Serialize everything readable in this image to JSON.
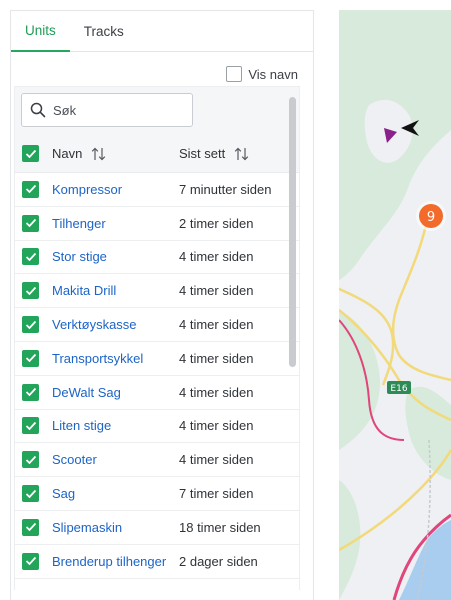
{
  "tabs": [
    {
      "label": "Units",
      "active": true
    },
    {
      "label": "Tracks",
      "active": false
    }
  ],
  "options": {
    "show_names_label": "Vis navn",
    "show_names_checked": false
  },
  "search": {
    "placeholder": "Søk",
    "value": ""
  },
  "table": {
    "headers": {
      "name": "Navn",
      "last_seen": "Sist sett"
    },
    "rows": [
      {
        "name": "Kompressor",
        "last_seen": "7 minutter siden",
        "checked": true
      },
      {
        "name": "Tilhenger",
        "last_seen": "2 timer siden",
        "checked": true
      },
      {
        "name": "Stor stige",
        "last_seen": "4 timer siden",
        "checked": true
      },
      {
        "name": "Makita Drill",
        "last_seen": "4 timer siden",
        "checked": true
      },
      {
        "name": "Verktøyskasse",
        "last_seen": "4 timer siden",
        "checked": true
      },
      {
        "name": "Transportsykkel",
        "last_seen": "4 timer siden",
        "checked": true
      },
      {
        "name": "DeWalt Sag",
        "last_seen": "4 timer siden",
        "checked": true
      },
      {
        "name": "Liten stige",
        "last_seen": "4 timer siden",
        "checked": true
      },
      {
        "name": "Scooter",
        "last_seen": "4 timer siden",
        "checked": true
      },
      {
        "name": "Sag",
        "last_seen": "7 timer siden",
        "checked": true
      },
      {
        "name": "Slipemaskin",
        "last_seen": "18 timer siden",
        "checked": true
      },
      {
        "name": "Brenderup tilhenger",
        "last_seen": "2 dager siden",
        "checked": true
      }
    ]
  },
  "map": {
    "cluster_count": "9",
    "road_label": "E16"
  },
  "colors": {
    "accent": "#22a45a",
    "link": "#1d64c6",
    "cluster": "#f26b2a",
    "road": "#f2d97a",
    "highway": "#e0457b"
  }
}
